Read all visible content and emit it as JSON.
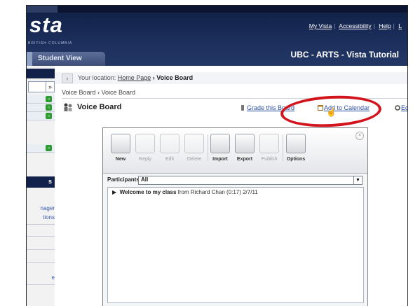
{
  "header": {
    "logo": "sta",
    "logo_sub": "BRITISH COLUMBIA",
    "links": [
      "My Vista",
      "Accessibility",
      "Help",
      "L"
    ],
    "course_title": "UBC - ARTS - Vista Tutorial",
    "view_tab": "Student View"
  },
  "sidebar": {
    "section_label": "s",
    "links": [
      "nager",
      "tions"
    ],
    "last_link": "e"
  },
  "location": {
    "prefix": "Your location:",
    "home": "Home Page",
    "arrow": "›",
    "current": "Voice Board"
  },
  "breadcrumb": "Voice Board › Voice Board",
  "page_title": "Voice Board",
  "actions": {
    "grade": "Grade this Board",
    "add_calendar": "Add to Calendar",
    "edit_settings": "Edit Sett"
  },
  "voiceboard": {
    "toolbar": [
      {
        "label": "New",
        "enabled": true,
        "icon": "new-icon"
      },
      {
        "label": "Reply",
        "enabled": false,
        "icon": "reply-icon"
      },
      {
        "label": "Edit",
        "enabled": false,
        "icon": "edit-icon"
      },
      {
        "label": "Delete",
        "enabled": false,
        "icon": "delete-icon"
      },
      {
        "label": "Import",
        "enabled": true,
        "icon": "import-icon"
      },
      {
        "label": "Export",
        "enabled": true,
        "icon": "export-icon"
      },
      {
        "label": "Publish",
        "enabled": false,
        "icon": "publish-icon"
      },
      {
        "label": "Options",
        "enabled": true,
        "icon": "options-icon"
      }
    ],
    "participants_label": "Participants:",
    "participants_value": "All",
    "messages": [
      {
        "title": "Welcome to my class",
        "meta": "from Richard Chan (0:17) 2/7/11"
      }
    ]
  }
}
